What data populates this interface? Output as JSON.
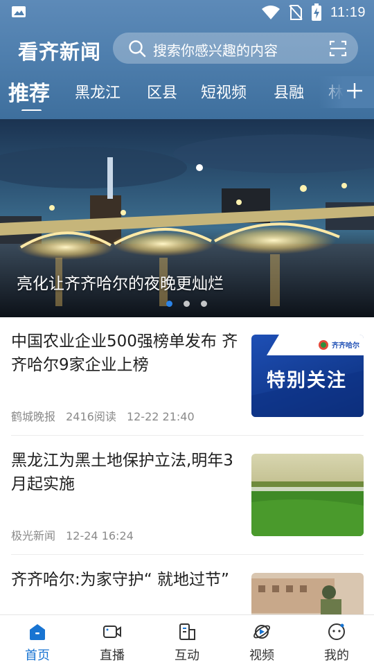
{
  "status_bar": {
    "time": "11:19",
    "left_icon": "image-icon",
    "right_icons": [
      "wifi-icon",
      "no-sim-icon",
      "battery-charging-icon"
    ]
  },
  "header": {
    "brand": "看齐新闻",
    "search_placeholder": "搜索你感兴趣的内容",
    "search_icon": "search-icon",
    "scan_icon": "scan-icon"
  },
  "tabs": [
    {
      "label": "推荐",
      "active": true
    },
    {
      "label": "黑龙江"
    },
    {
      "label": "区县"
    },
    {
      "label": "短视频"
    },
    {
      "label": "县融"
    },
    {
      "label": "林"
    }
  ],
  "banner": {
    "caption": "亮化让齐齐哈尔的夜晚更灿烂",
    "slide_count": 3,
    "active_slide": 1
  },
  "news": [
    {
      "title": "中国农业企业500强榜单发布 齐齐哈尔9家企业上榜",
      "source": "鹤城晚报",
      "reads": "2416阅读",
      "time": "12-22 21:40",
      "thumb_text": "特别关注",
      "thumb_logo": "齐齐哈尔"
    },
    {
      "title": "黑龙江为黑土地保护立法,明年3月起实施",
      "source": "极光新闻",
      "reads": "",
      "time": "12-24 16:24"
    },
    {
      "title": "齐齐哈尔:为家守护“ 就地过节”",
      "source": "",
      "reads": "",
      "time": ""
    }
  ],
  "bottom_nav": [
    {
      "label": "首页",
      "icon": "home-icon",
      "active": true
    },
    {
      "label": "直播",
      "icon": "video-camera-icon"
    },
    {
      "label": "互动",
      "icon": "buildings-icon"
    },
    {
      "label": "视频",
      "icon": "play-orbit-icon"
    },
    {
      "label": "我的",
      "icon": "face-icon"
    }
  ],
  "colors": {
    "header": "#4f7fae",
    "accent": "#1874d2",
    "active_dot": "#2b83e6"
  }
}
